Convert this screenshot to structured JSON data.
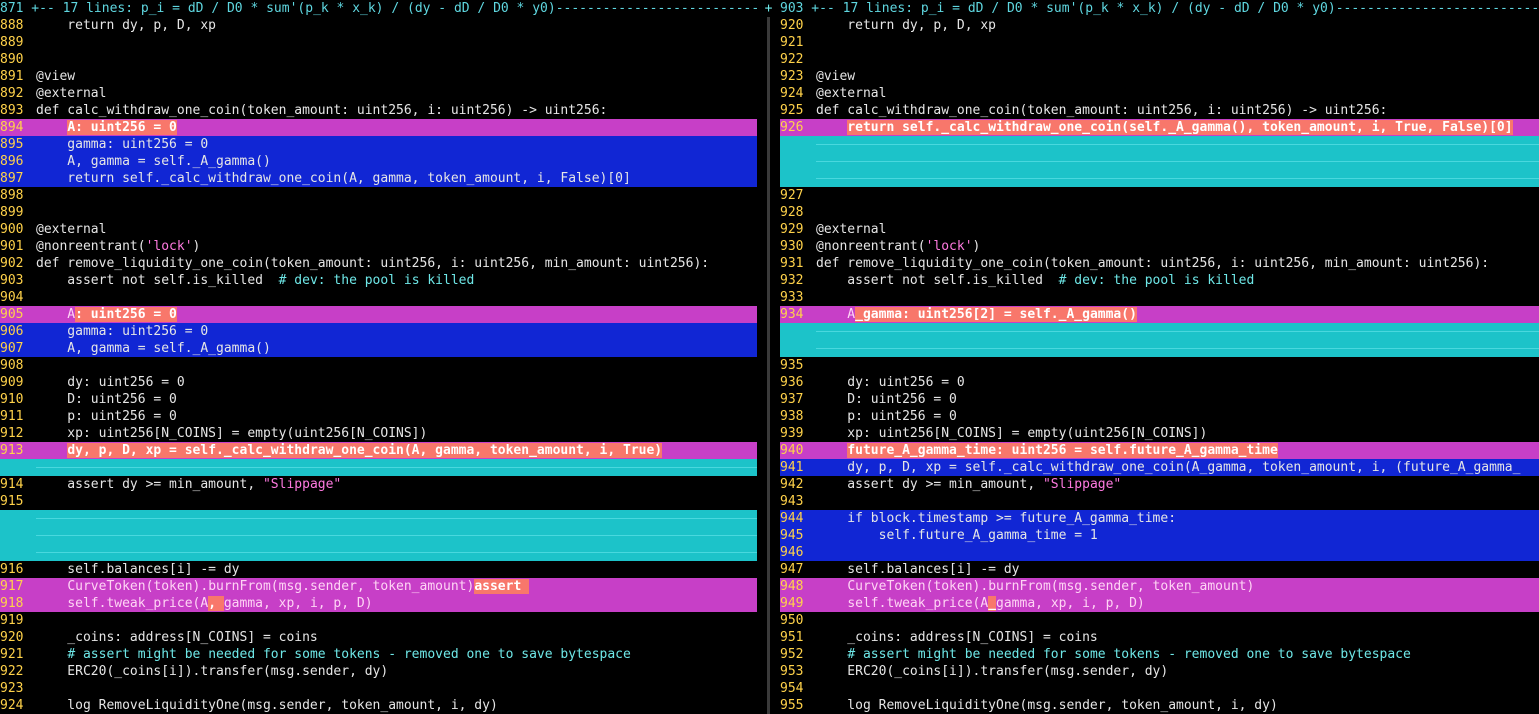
{
  "left": {
    "fold": "871 +-- 17 lines: p_i = dD / D0 * sum'(p_k * x_k) / (dy - dD / D0 * y0)-------------------------------",
    "rows": [
      {
        "n": "888",
        "c": "    return dy, p, D, xp"
      },
      {
        "n": "889",
        "c": ""
      },
      {
        "n": "890",
        "c": ""
      },
      {
        "n": "891",
        "c": "@view"
      },
      {
        "n": "892",
        "c": "@external"
      },
      {
        "n": "893",
        "c": "def calc_withdraw_one_coin(token_amount: uint256, i: uint256) -> uint256:"
      },
      {
        "n": "894",
        "t": "chg",
        "c": "    ",
        "h": "A: uint256 = 0"
      },
      {
        "n": "895",
        "t": "add",
        "c": "    gamma: uint256 = 0"
      },
      {
        "n": "896",
        "t": "add",
        "c": "    A, gamma = self._A_gamma()"
      },
      {
        "n": "897",
        "t": "add",
        "c": "    return self._calc_withdraw_one_coin(A, gamma, token_amount, i, False)[0]"
      },
      {
        "n": "898",
        "c": ""
      },
      {
        "n": "899",
        "c": ""
      },
      {
        "n": "900",
        "c": "@external"
      },
      {
        "n": "901",
        "c": "@nonreentrant(",
        "s": "'lock'",
        "e": ")"
      },
      {
        "n": "902",
        "c": "def remove_liquidity_one_coin(token_amount: uint256, i: uint256, min_amount: uint256):"
      },
      {
        "n": "903",
        "c": "    assert not self.is_killed  ",
        "m": "# dev: the pool is killed"
      },
      {
        "n": "904",
        "c": ""
      },
      {
        "n": "905",
        "t": "chg",
        "c": "    A",
        "h": ": uint256 = 0"
      },
      {
        "n": "906",
        "t": "add",
        "c": "    gamma: uint256 = 0"
      },
      {
        "n": "907",
        "t": "add",
        "c": "    A, gamma = self._A_gamma()"
      },
      {
        "n": "908",
        "c": ""
      },
      {
        "n": "909",
        "c": "    dy: uint256 = 0"
      },
      {
        "n": "910",
        "c": "    D: uint256 = 0"
      },
      {
        "n": "911",
        "c": "    p: uint256 = 0"
      },
      {
        "n": "912",
        "c": "    xp: uint256[N_COINS] = empty(uint256[N_COINS])"
      },
      {
        "n": "913",
        "t": "chg",
        "c": "    ",
        "h": "dy, p, D, xp = self._calc_withdraw_one_coin(A, gamma, token_amount, i, True)"
      },
      {
        "n": "",
        "t": "del",
        "c": ""
      },
      {
        "n": "914",
        "c": "    assert dy >= min_amount, ",
        "s": "\"Slippage\""
      },
      {
        "n": "915",
        "c": ""
      },
      {
        "n": "",
        "t": "del",
        "c": ""
      },
      {
        "n": "",
        "t": "del",
        "c": ""
      },
      {
        "n": "",
        "t": "del",
        "c": ""
      },
      {
        "n": "916",
        "c": "    self.balances[i] -= dy"
      },
      {
        "n": "917",
        "t": "chg",
        "c": "    ",
        "h": "assert ",
        "x": "CurveToken(token).burnFrom(msg.sender, token_amount)"
      },
      {
        "n": "918",
        "t": "chg",
        "c": "    ",
        "x": "self.tweak_price(A",
        "h": ", ",
        "y": "gamma, xp, i, p, D)"
      },
      {
        "n": "919",
        "c": ""
      },
      {
        "n": "920",
        "c": "    _coins: address[N_COINS] = coins"
      },
      {
        "n": "921",
        "c": "    ",
        "m": "# assert might be needed for some tokens - removed one to save bytespace"
      },
      {
        "n": "922",
        "c": "    ERC20(_coins[i]).transfer(msg.sender, dy)"
      },
      {
        "n": "923",
        "c": ""
      },
      {
        "n": "924",
        "c": "    log RemoveLiquidityOne(msg.sender, token_amount, i, dy)"
      }
    ]
  },
  "right": {
    "fold": "903 +-- 17 lines: p_i = dD / D0 * sum'(p_k * x_k) / (dy - dD / D0 * y0)-------------------------------",
    "rows": [
      {
        "n": "920",
        "c": "    return dy, p, D, xp"
      },
      {
        "n": "921",
        "c": ""
      },
      {
        "n": "922",
        "c": ""
      },
      {
        "n": "923",
        "c": "@view"
      },
      {
        "n": "924",
        "c": "@external"
      },
      {
        "n": "925",
        "c": "def calc_withdraw_one_coin(token_amount: uint256, i: uint256) -> uint256:"
      },
      {
        "n": "926",
        "t": "chg",
        "c": "    ",
        "h": "return self._calc_withdraw_one_coin(self._A_gamma(), token_amount, i, True, False)[0]"
      },
      {
        "n": "",
        "t": "del",
        "c": ""
      },
      {
        "n": "",
        "t": "del",
        "c": ""
      },
      {
        "n": "",
        "t": "del",
        "c": ""
      },
      {
        "n": "927",
        "c": ""
      },
      {
        "n": "928",
        "c": ""
      },
      {
        "n": "929",
        "c": "@external"
      },
      {
        "n": "930",
        "c": "@nonreentrant(",
        "s": "'lock'",
        "e": ")"
      },
      {
        "n": "931",
        "c": "def remove_liquidity_one_coin(token_amount: uint256, i: uint256, min_amount: uint256):"
      },
      {
        "n": "932",
        "c": "    assert not self.is_killed  ",
        "m": "# dev: the pool is killed"
      },
      {
        "n": "933",
        "c": ""
      },
      {
        "n": "934",
        "t": "chg",
        "c": "    A",
        "h": "_gamma: uint256[2] = self._A_gamma()"
      },
      {
        "n": "",
        "t": "del",
        "c": ""
      },
      {
        "n": "",
        "t": "del",
        "c": ""
      },
      {
        "n": "935",
        "c": ""
      },
      {
        "n": "936",
        "c": "    dy: uint256 = 0"
      },
      {
        "n": "937",
        "c": "    D: uint256 = 0"
      },
      {
        "n": "938",
        "c": "    p: uint256 = 0"
      },
      {
        "n": "939",
        "c": "    xp: uint256[N_COINS] = empty(uint256[N_COINS])"
      },
      {
        "n": "940",
        "t": "chg",
        "c": "    ",
        "h": "future_A_gamma_time: uint256 = self.future_A_gamma_time"
      },
      {
        "n": "941",
        "t": "add",
        "c": "    dy, p, D, xp = self._calc_withdraw_one_coin(A_gamma, token_amount, i, (future_A_gamma_"
      },
      {
        "n": "942",
        "c": "    assert dy >= min_amount, ",
        "s": "\"Slippage\""
      },
      {
        "n": "943",
        "c": ""
      },
      {
        "n": "944",
        "t": "add",
        "c": "    if block.timestamp >= future_A_gamma_time:"
      },
      {
        "n": "945",
        "t": "add",
        "c": "        self.future_A_gamma_time = 1"
      },
      {
        "n": "946",
        "t": "add",
        "c": ""
      },
      {
        "n": "947",
        "c": "    self.balances[i] -= dy"
      },
      {
        "n": "948",
        "t": "chg",
        "c": "    ",
        "x": "CurveToken(token).burnFrom(msg.sender, token_amount)"
      },
      {
        "n": "949",
        "t": "chg",
        "c": "    ",
        "x": "self.tweak_price(A",
        "h": "_",
        "y": "gamma, xp, i, p, D)"
      },
      {
        "n": "950",
        "c": ""
      },
      {
        "n": "951",
        "c": "    _coins: address[N_COINS] = coins"
      },
      {
        "n": "952",
        "c": "    ",
        "m": "# assert might be needed for some tokens - removed one to save bytespace"
      },
      {
        "n": "953",
        "c": "    ERC20(_coins[i]).transfer(msg.sender, dy)"
      },
      {
        "n": "954",
        "c": ""
      },
      {
        "n": "955",
        "c": "    log RemoveLiquidityOne(msg.sender, token_amount, i, dy)"
      }
    ]
  },
  "separator": {
    "top": "+"
  },
  "colors": {
    "added": "#1126d4",
    "changed": "#c73fc7",
    "deleted": "#1cc3c9",
    "text_change": "#f8776b",
    "line_number": "#ffd24a"
  }
}
